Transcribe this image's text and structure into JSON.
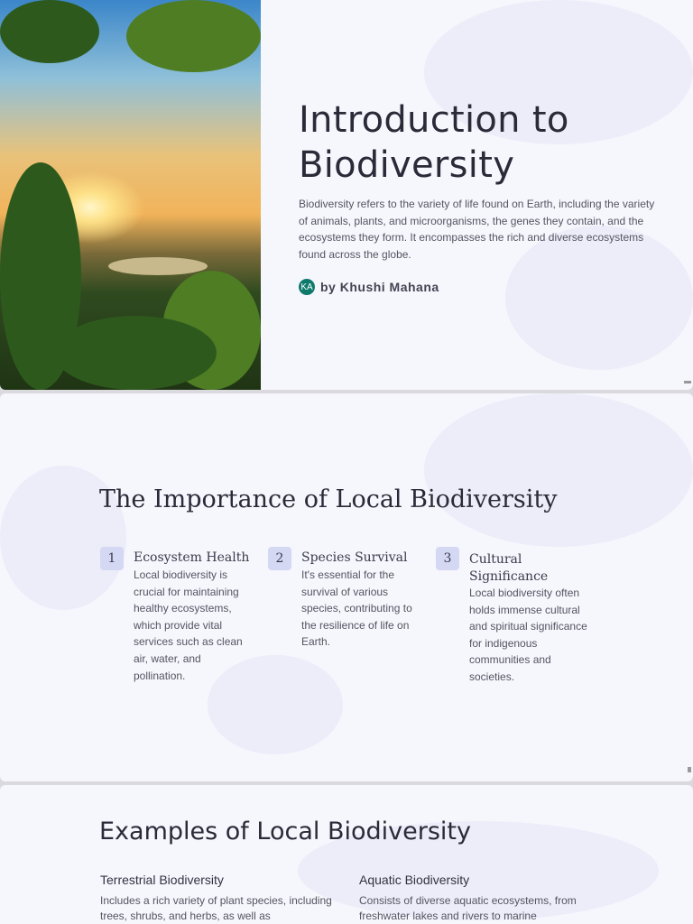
{
  "slide1": {
    "title": "Introduction to Biodiversity",
    "description": "Biodiversity refers to the variety of life found on Earth, including the variety of animals, plants, and microorganisms, the genes they contain, and the ecosystems they form. It encompasses the rich and diverse ecosystems found across the globe.",
    "author_initials": "KA",
    "author": "by Khushi Mahana"
  },
  "slide2": {
    "title": "The Importance of Local Biodiversity",
    "cards": [
      {
        "number": "1",
        "title": "Ecosystem Health",
        "text": "Local biodiversity is crucial for maintaining healthy ecosystems, which provide vital services such as clean air, water, and pollination."
      },
      {
        "number": "2",
        "title": "Species Survival",
        "text": "It's essential for the survival of various species, contributing to the resilience of life on Earth."
      },
      {
        "number": "3",
        "title": "Cultural Significance",
        "text": "Local biodiversity often holds immense cultural and spiritual significance for indigenous communities and societies."
      }
    ]
  },
  "slide3": {
    "title": "Examples of Local Biodiversity",
    "items": [
      {
        "title": "Terrestrial Biodiversity",
        "text": "Includes a rich variety of plant species, including trees, shrubs, and herbs, as well as"
      },
      {
        "title": "Aquatic Biodiversity",
        "text": "Consists of diverse aquatic ecosystems, from freshwater lakes and rivers to marine"
      }
    ]
  },
  "colors": {
    "accent": "#0e7a6c",
    "badge": "#d4d8f3",
    "slide_bg": "#f6f6fd"
  }
}
